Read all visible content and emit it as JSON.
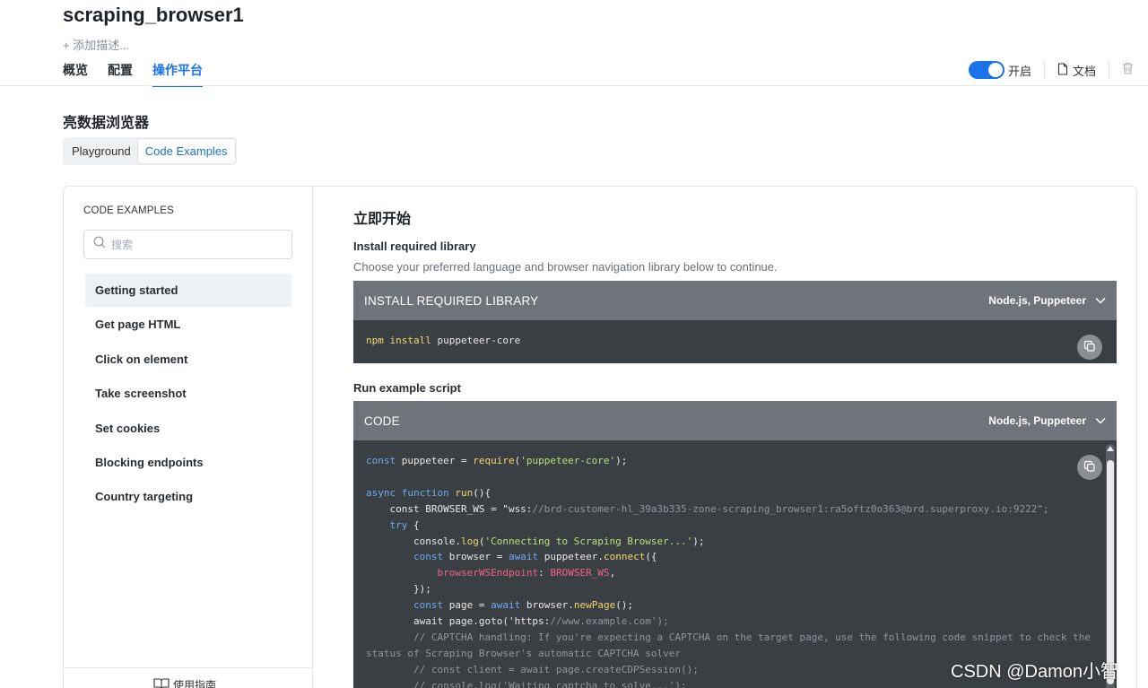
{
  "header": {
    "title": "scraping_browser1",
    "add_description": "+ 添加描述...",
    "tabs": [
      {
        "label": "概览"
      },
      {
        "label": "配置"
      },
      {
        "label": "操作平台",
        "active": true
      }
    ],
    "toggle_label": "开启",
    "toggle_on": true,
    "docs_label": "文档"
  },
  "section": {
    "title": "亮数据浏览器",
    "segments": [
      {
        "label": "Playground"
      },
      {
        "label": "Code Examples",
        "active": true
      }
    ]
  },
  "sidebar": {
    "heading": "CODE EXAMPLES",
    "search_placeholder": "搜索",
    "items": [
      {
        "label": "Getting started",
        "active": true
      },
      {
        "label": "Get page HTML"
      },
      {
        "label": "Click on element"
      },
      {
        "label": "Take screenshot"
      },
      {
        "label": "Set cookies"
      },
      {
        "label": "Blocking endpoints"
      },
      {
        "label": "Country targeting"
      }
    ],
    "guide_label": "使用指南"
  },
  "main": {
    "title": "立即开始",
    "install_heading": "Install required library",
    "install_desc": "Choose your preferred language and browser navigation library below to continue.",
    "install_block": {
      "title": "INSTALL REQUIRED LIBRARY",
      "lang": "Node.js, Puppeteer",
      "cmd_word1": "npm",
      "cmd_word2": "install",
      "cmd_arg": "puppeteer-core"
    },
    "run_heading": "Run example script",
    "code_block": {
      "title": "CODE",
      "lang": "Node.js, Puppeteer",
      "lines": [
        "const puppeteer = require('puppeteer-core');",
        "",
        "async function run(){",
        "    const BROWSER_WS = \"wss://brd-customer-hl_39a3b335-zone-scraping_browser1:ra5oftz0o363@brd.superproxy.io:9222\";",
        "    try {",
        "        console.log('Connecting to Scraping Browser...');",
        "        const browser = await puppeteer.connect({",
        "            browserWSEndpoint: BROWSER_WS,",
        "        });",
        "        const page = await browser.newPage();",
        "        await page.goto('https://www.example.com');",
        "        // CAPTCHA handling: If you're expecting a CAPTCHA on the target page, use the following code snippet to check the",
        "status of Scraping Browser's automatic CAPTCHA solver",
        "        // const client = await page.createCDPSession();",
        "        // console.log('Waiting captcha to solve...');"
      ]
    }
  },
  "watermark": "CSDN @Damon小智",
  "colors": {
    "accent": "#1a73e8",
    "code_bg": "#3a3f44",
    "code_header_bg": "#6f747a"
  }
}
